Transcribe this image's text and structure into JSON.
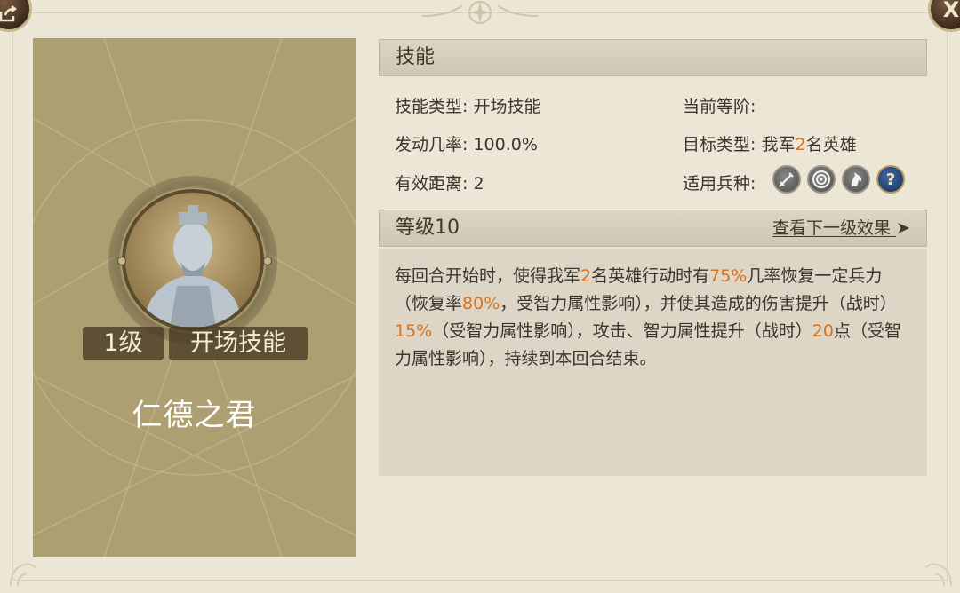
{
  "buttons": {
    "share_icon": "share-icon",
    "close_label": "X"
  },
  "card": {
    "level_tag": "1级",
    "type_tag": "开场技能",
    "name": "仁德之君",
    "portrait_icon": "scholar-portrait"
  },
  "skill_section": {
    "header": "技能",
    "skill_type_label": "技能类型:",
    "skill_type_value": "开场技能",
    "current_rank_label": "当前等阶:",
    "current_rank_value": "",
    "trigger_rate_label": "发动几率:",
    "trigger_rate_value": "100.0%",
    "target_type_label": "目标类型:",
    "target_prefix": "我军",
    "target_count": "2",
    "target_suffix": "名英雄",
    "range_label": "有效距离:",
    "range_value": "2",
    "troop_label": "适用兵种:",
    "troop_icons": [
      "sword-icon",
      "target-icon",
      "horse-icon",
      "question-icon"
    ]
  },
  "level_section": {
    "header": "等级10",
    "next_level_link": "查看下一级效果",
    "next_icon": "arrow-right-icon"
  },
  "description": {
    "p1": "每回合开始时，使得我军",
    "v1": "2",
    "p2": "名英雄行动时有",
    "v2": "75%",
    "p3": "几率恢复一定兵力（恢复率",
    "v3": "80%",
    "p4": "，受智力属性影响），并使其造成的伤害提升（战时）",
    "v4": "15%",
    "p5": "（受智力属性影响），攻击、智力属性提升（战时）",
    "v5": "20",
    "p6": "点（受智力属性影响），持续到本回合结束。"
  },
  "colors": {
    "highlight": "#d9731e",
    "card_bg": "#ae9f72",
    "panel_bg": "#ece6d6"
  }
}
